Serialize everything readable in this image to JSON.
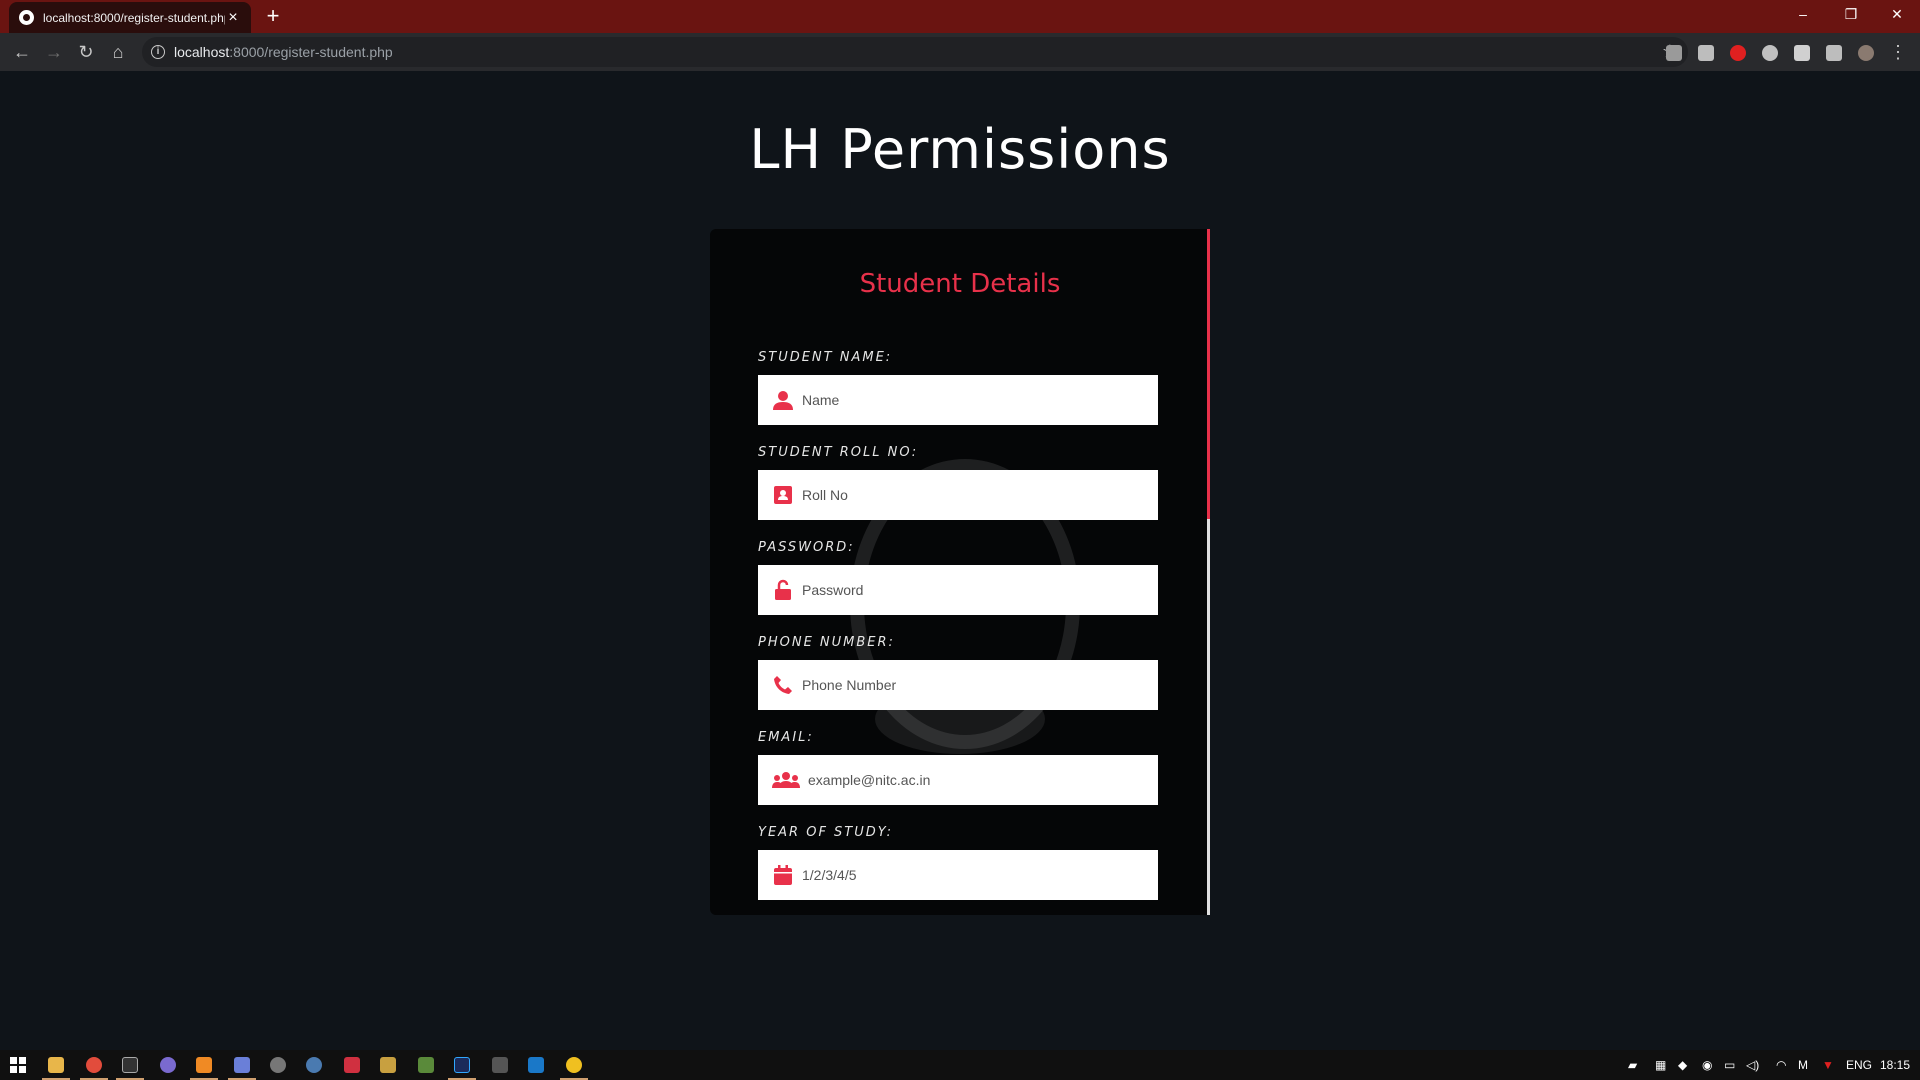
{
  "browser": {
    "tab_title": "localhost:8000/register-student.php",
    "tab_close": "×",
    "new_tab": "+",
    "url_host": "localhost",
    "url_rest": ":8000/register-student.php",
    "window_controls": {
      "minimize": "–",
      "restore": "❐",
      "close": "✕"
    }
  },
  "page": {
    "title": "LH Permissions",
    "card_heading": "Student Details",
    "fields": [
      {
        "label": "STUDENT NAME:",
        "placeholder": "Name",
        "icon": "user-icon"
      },
      {
        "label": "STUDENT ROLL NO:",
        "placeholder": "Roll No",
        "icon": "id-card-icon"
      },
      {
        "label": "PASSWORD:",
        "placeholder": "Password",
        "icon": "unlock-icon"
      },
      {
        "label": "PHONE NUMBER:",
        "placeholder": "Phone Number",
        "icon": "phone-icon"
      },
      {
        "label": "EMAIL:",
        "placeholder": "example@nitc.ac.in",
        "icon": "users-icon"
      },
      {
        "label": "YEAR OF STUDY:",
        "placeholder": "1/2/3/4/5",
        "icon": "calendar-icon"
      }
    ],
    "accent_color": "#e8314a",
    "background_color": "#0f1419"
  },
  "taskbar": {
    "language": "ENG",
    "time": "18:15"
  }
}
